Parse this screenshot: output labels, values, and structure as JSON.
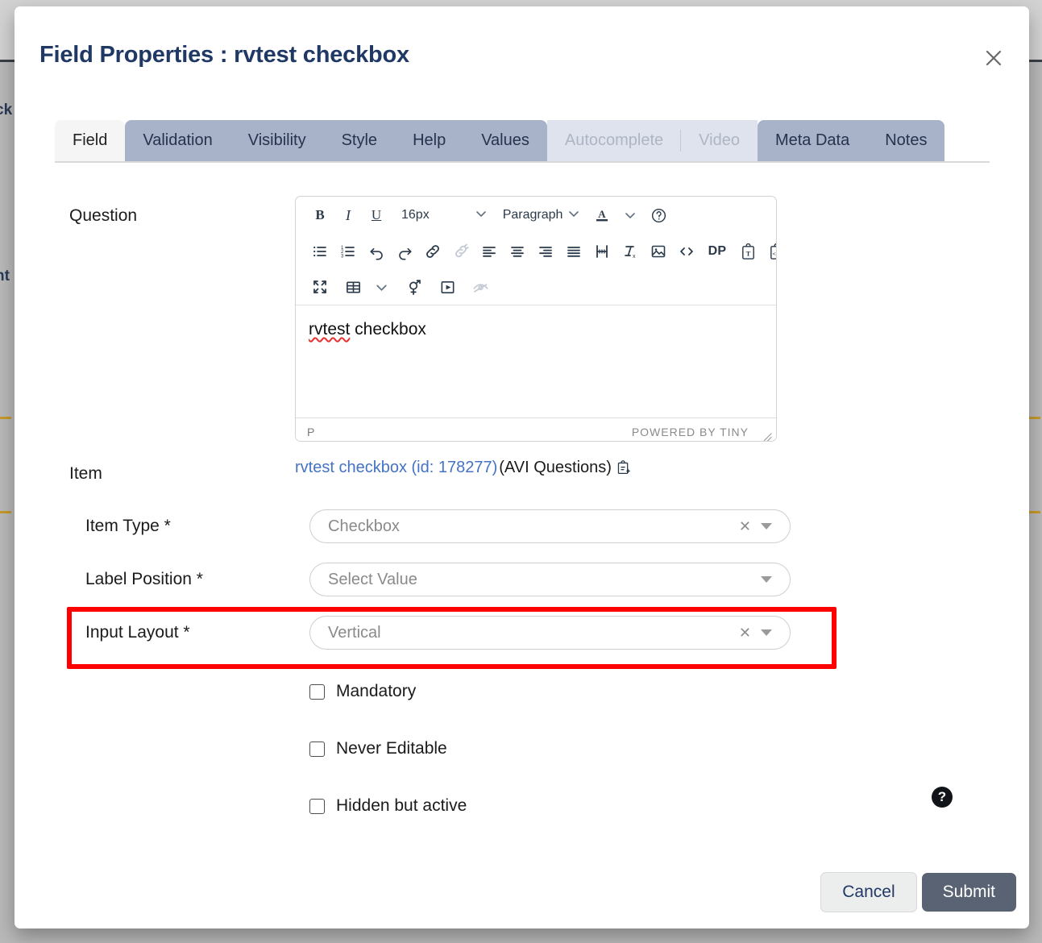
{
  "background": {
    "fragment_left_1": "ck",
    "fragment_left_2": "nt"
  },
  "modal": {
    "title": "Field Properties : rvtest checkbox",
    "close_label": "×"
  },
  "tabs": [
    {
      "label": "Field",
      "state": "active"
    },
    {
      "label": "Validation",
      "state": "normal"
    },
    {
      "label": "Visibility",
      "state": "normal"
    },
    {
      "label": "Style",
      "state": "normal"
    },
    {
      "label": "Help",
      "state": "normal"
    },
    {
      "label": "Values",
      "state": "normal"
    },
    {
      "label": "Autocomplete",
      "state": "disabled"
    },
    {
      "label": "Video",
      "state": "disabled"
    },
    {
      "label": "Meta Data",
      "state": "normal"
    },
    {
      "label": "Notes",
      "state": "normal"
    }
  ],
  "form": {
    "question": {
      "label": "Question",
      "editor": {
        "font_size": "16px",
        "block_format": "Paragraph",
        "content": "rvtest checkbox",
        "content_misspelled": "rvtest",
        "content_rest": " checkbox",
        "status_path": "P",
        "status_branding": "POWERED BY TINY",
        "toolbar_row1": [
          "bold-icon",
          "italic-icon",
          "underline-icon",
          "font-size-select",
          "block-format-select",
          "text-color-icon",
          "help-icon"
        ],
        "toolbar_row2": [
          "bullet-list-icon",
          "numbered-list-icon",
          "undo-icon",
          "redo-icon",
          "link-icon",
          "unlink-icon",
          "align-left-icon",
          "align-center-icon",
          "align-right-icon",
          "align-justify-icon",
          "page-break-icon",
          "clear-formatting-icon",
          "insert-image-icon",
          "source-code-icon",
          "dp-button",
          "paste-as-text-icon",
          "paste-as-html-icon"
        ],
        "toolbar_row3": [
          "fullscreen-icon",
          "table-icon",
          "table-chevron-icon",
          "gender-symbol-icon",
          "media-icon",
          "preview-hidden-icon"
        ],
        "dp_label": "DP"
      }
    },
    "item": {
      "label": "Item",
      "link_text": "rvtest checkbox (id: 178277)",
      "suffix_text": " (AVI Questions)",
      "copy_icon": "copy-to-clipboard-icon"
    },
    "item_type": {
      "label": "Item Type *",
      "value": "Checkbox",
      "has_clear": true
    },
    "label_position": {
      "label": "Label Position *",
      "value": "Select Value",
      "has_clear": false
    },
    "input_layout": {
      "label": "Input Layout *",
      "value": "Vertical",
      "has_clear": true,
      "highlighted": true,
      "highlight_color": "#ff0000"
    },
    "checkboxes": [
      {
        "label": "Mandatory",
        "checked": false
      },
      {
        "label": "Never Editable",
        "checked": false
      },
      {
        "label": "Hidden but active",
        "checked": false
      }
    ],
    "help_fab": "?"
  },
  "footer": {
    "cancel_label": "Cancel",
    "submit_label": "Submit"
  },
  "colors": {
    "title": "#1f3864",
    "tab_active_bg": "#f5f5f5",
    "tab_bg": "#a8b2c9",
    "tab_disabled_bg": "#dfe3ed",
    "link": "#4472c4",
    "submit_bg": "#5a6373",
    "highlight": "#ff0000"
  }
}
